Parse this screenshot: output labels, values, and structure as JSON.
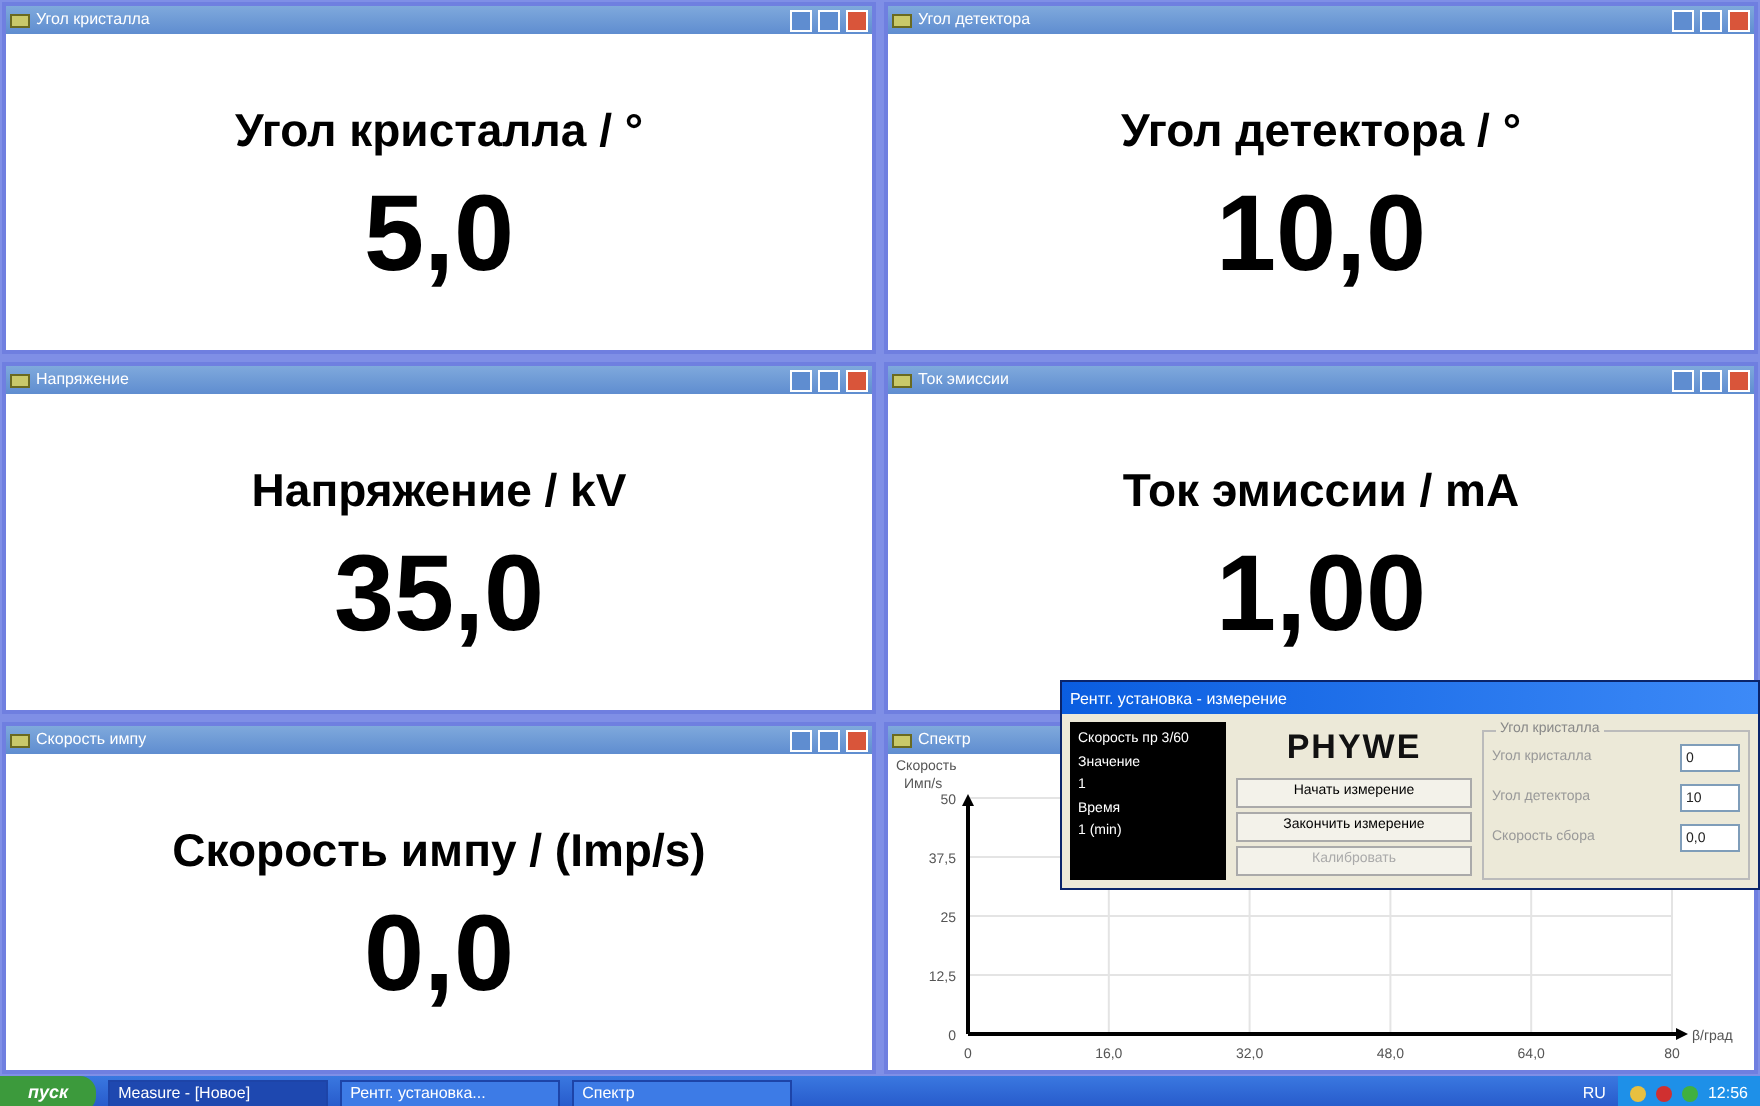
{
  "windows": [
    {
      "title": "Угол кристалла",
      "kind": "display",
      "heading": "Угол кристалла / °",
      "value": "5,0"
    },
    {
      "title": "Угол детектора",
      "kind": "display",
      "heading": "Угол детектора / °",
      "value": "10,0"
    },
    {
      "title": "Напряжение",
      "kind": "display",
      "heading": "Напряжение / kV",
      "value": "35,0"
    },
    {
      "title": "Ток эмиссии",
      "kind": "display",
      "heading": "Ток эмиссии / mA",
      "value": "1,00"
    },
    {
      "title": "Скорость импу",
      "kind": "display",
      "heading": "Скорость импу / (Imp/s)",
      "value": "0,0"
    },
    {
      "title": "Спектр",
      "kind": "chart",
      "legend": "Скорость",
      "chart_data": {
        "type": "line",
        "grid": true,
        "ylabel": "Имп/s",
        "xlabel": "β/град",
        "xlim": [
          0,
          80
        ],
        "ylim": [
          0,
          50
        ],
        "xticks": [
          {
            "value": 0,
            "label": "0"
          },
          {
            "value": 16,
            "label": "16,0"
          },
          {
            "value": 32,
            "label": "32,0"
          },
          {
            "value": 48,
            "label": "48,0"
          },
          {
            "value": 64,
            "label": "64,0"
          },
          {
            "value": 80,
            "label": "80"
          }
        ],
        "yticks": [
          {
            "value": 0,
            "label": "0"
          },
          {
            "value": 12.5,
            "label": "12,5"
          },
          {
            "value": 25,
            "label": "25"
          },
          {
            "value": 37.5,
            "label": "37,5"
          },
          {
            "value": 50,
            "label": "50"
          }
        ]
      }
    }
  ],
  "dialog": {
    "title": "Рентг. установка - измерение",
    "readout": [
      "Скорость пр 3/60",
      "Значение",
      "1",
      "Время",
      "1 (min)"
    ],
    "logo": "PHYWE",
    "buttons": [
      {
        "label": "Начать измерение",
        "disabled": false
      },
      {
        "label": "Закончить измерение",
        "disabled": false
      },
      {
        "label": "Калибровать",
        "disabled": true
      }
    ],
    "group": "Угол кристалла",
    "fields": [
      {
        "label": "Угол кристалла",
        "value": "0"
      },
      {
        "label": "Угол детектора",
        "value": "10"
      },
      {
        "label": "Скорость сбора",
        "value": "0,0"
      }
    ]
  },
  "taskbar": {
    "start": "пуск",
    "tasks": [
      {
        "label": "Measure - [Новое]",
        "selected": true
      },
      {
        "label": "Рентг. установка...",
        "selected": false
      },
      {
        "label": "Спектр",
        "selected": false
      }
    ],
    "language": "RU",
    "clock": "12:56"
  }
}
